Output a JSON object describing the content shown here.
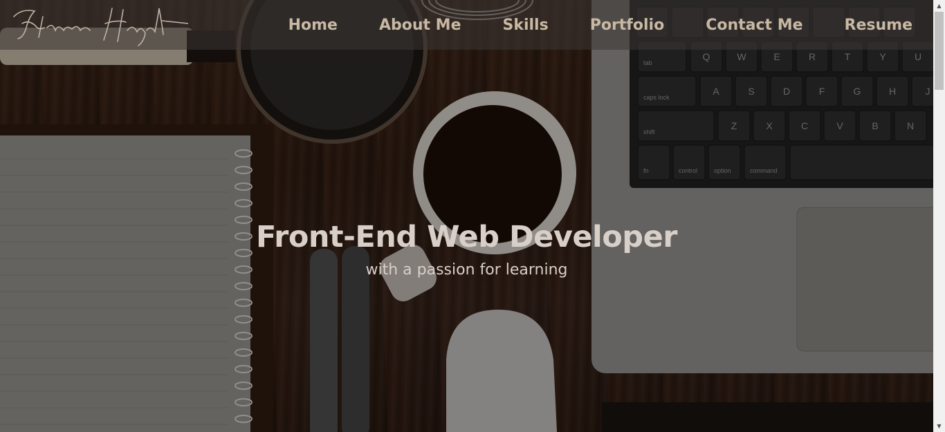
{
  "logo": {
    "text": "Khawar Hayat"
  },
  "nav": {
    "items": [
      {
        "label": "Home",
        "name": "nav-home"
      },
      {
        "label": "About Me",
        "name": "nav-about-me"
      },
      {
        "label": "Skills",
        "name": "nav-skills"
      },
      {
        "label": "Portfolio",
        "name": "nav-portfolio"
      },
      {
        "label": "Contact Me",
        "name": "nav-contact-me"
      },
      {
        "label": "Resume",
        "name": "nav-resume"
      }
    ]
  },
  "hero": {
    "title": "Front-End Web Developer",
    "subtitle": "with a passion for learning"
  },
  "keyboard": {
    "keys_row1": [
      "Q",
      "W",
      "E",
      "R",
      "T",
      "Y",
      "U"
    ],
    "keys_row2": [
      "A",
      "S",
      "D",
      "F",
      "G",
      "H",
      "J"
    ],
    "keys_row3": [
      "Z",
      "X",
      "C",
      "V",
      "B",
      "N"
    ],
    "mod_tab": "tab",
    "mod_caps": "caps lock",
    "mod_shift": "shift",
    "mod_fn": "fn",
    "mod_control": "control",
    "mod_option": "option",
    "mod_command": "command"
  },
  "colors": {
    "nav_text": "#c9b9a3",
    "hero_text": "#d8cfc8",
    "navbar_bg": "rgba(60,55,52,0.55)"
  },
  "scrollbar": {
    "up_icon": "▲",
    "down_icon": "▼"
  }
}
